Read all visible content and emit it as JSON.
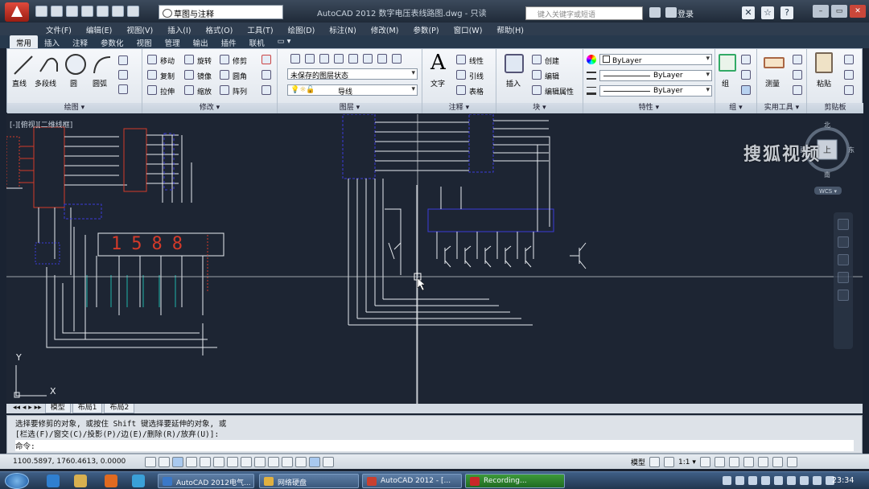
{
  "title_bar": {
    "workspace": "草图与注释",
    "window_title": "AutoCAD 2012    数字电压表线路图.dwg - 只读",
    "search_placeholder": "键入关键字或短语",
    "login_label": "登录"
  },
  "menu": [
    "文件(F)",
    "编辑(E)",
    "视图(V)",
    "插入(I)",
    "格式(O)",
    "工具(T)",
    "绘图(D)",
    "标注(N)",
    "修改(M)",
    "参数(P)",
    "窗口(W)",
    "帮助(H)"
  ],
  "ribbon_tabs": [
    "常用",
    "插入",
    "注释",
    "参数化",
    "视图",
    "管理",
    "输出",
    "插件",
    "联机",
    "▭ ▾"
  ],
  "ribbon": {
    "draw": {
      "title": "绘图 ▾",
      "line": "直线",
      "polyline": "多段线",
      "circle": "圆",
      "arc": "圆弧"
    },
    "modify": {
      "title": "修改 ▾",
      "move": "移动",
      "rotate": "旋转",
      "trim": "修剪",
      "copy": "复制",
      "mirror": "镜像",
      "fillet": "圆角",
      "stretch": "拉伸",
      "scale": "缩放",
      "array": "阵列"
    },
    "layers": {
      "title": "图层 ▾",
      "layer_state": "未保存的图层状态",
      "layer_name": "导线"
    },
    "annotation": {
      "title": "注释 ▾",
      "text": "文字",
      "linear": "线性",
      "leader": "引线",
      "table": "表格"
    },
    "block": {
      "title": "块 ▾",
      "insert": "插入",
      "create": "创建",
      "edit": "编辑",
      "edit_attr": "编辑属性"
    },
    "properties": {
      "title": "特性 ▾",
      "color": "ByLayer",
      "linetype": "ByLayer",
      "lineweight": "ByLayer"
    },
    "group": {
      "title": "组 ▾",
      "group": "组"
    },
    "utilities": {
      "title": "实用工具 ▾",
      "measure": "测量"
    },
    "clipboard": {
      "title": "剪贴板",
      "paste": "粘贴"
    }
  },
  "drawing": {
    "viewport_label": "[-][俯视][二维线框]",
    "digits": "1588",
    "ucs_x": "X",
    "ucs_y": "Y",
    "viewcube": {
      "north": "北",
      "south": "南",
      "east": "东",
      "west": "西",
      "top": "上",
      "wcs": "WCS ▾"
    },
    "watermark": "搜狐视频"
  },
  "layout_tabs": [
    "模型",
    "布局1",
    "布局2"
  ],
  "command": {
    "line1": "选择要修剪的对象, 或按住 Shift 键选择要延伸的对象, 或",
    "line2": "[栏选(F)/窗交(C)/投影(P)/边(E)/删除(R)/放弃(U)]:",
    "prompt": "命令:"
  },
  "status": {
    "coords": "1100.5897,  1760.4613,  0.0000",
    "model": "模型",
    "scale": "1:1 ▾"
  },
  "taskbar": {
    "tasks": [
      "AutoCAD 2012电气...",
      "网络硬盘",
      "AutoCAD 2012 - [...",
      "Recording..."
    ],
    "task_colors": [
      "#3a78c8",
      "#e0b040",
      "#c84030",
      "#c82828"
    ],
    "clock": "23:34"
  },
  "colors": {
    "accent_red": "#d23a2a",
    "wire_white": "#e8ecf0",
    "component_blue": "#3a3ad8"
  }
}
